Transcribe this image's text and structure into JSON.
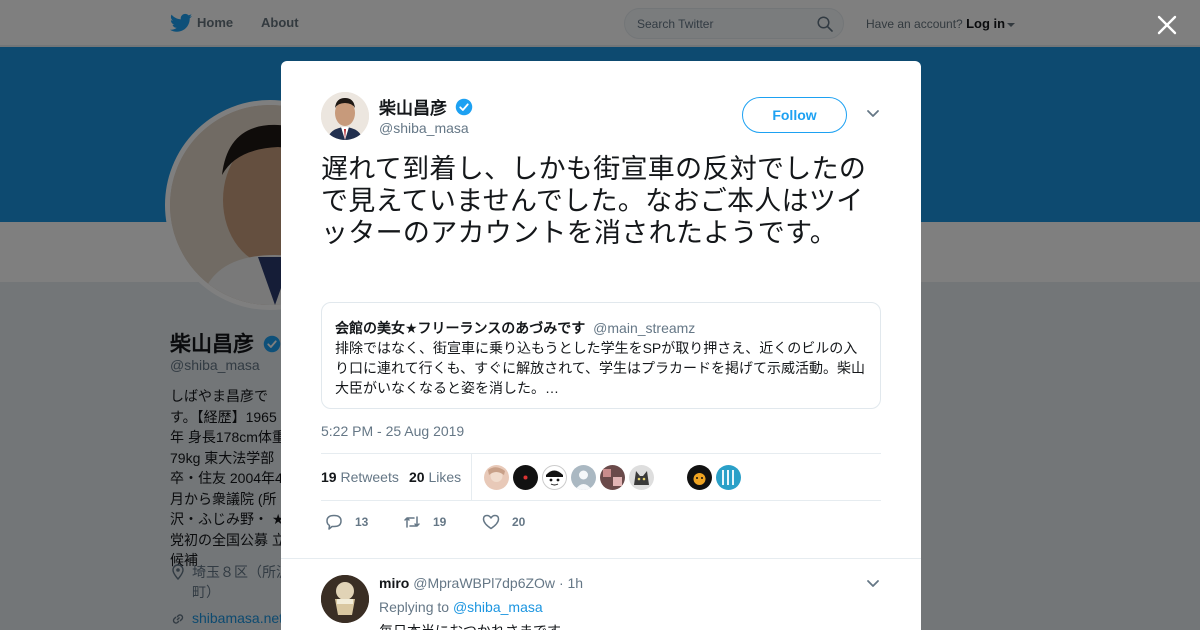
{
  "nav": {
    "home": "Home",
    "about": "About",
    "search_placeholder": "Search Twitter",
    "have_account": "Have an account?",
    "login": "Log in"
  },
  "profile": {
    "name": "柴山昌彦",
    "handle": "@shiba_masa",
    "bio": "しばやま昌彦です。【経歴】1965年 身長178cm体重79kg 東大法学部卒・住友 2004年4月から衆議院 (所沢・ふじみ野・ ★党初の全国公募 立候補",
    "location": "埼玉８区（所沢 町）",
    "url": "shibamasa.net"
  },
  "tweet": {
    "author_name": "柴山昌彦",
    "author_handle": "@shiba_masa",
    "follow_label": "Follow",
    "text": "遅れて到着し、しかも街宣車の反対でしたので見えていませんでした。なおご本人はツイッターのアカウントを消されたようです。",
    "quote": {
      "name": "会館の美女★フリーランスのあづみです",
      "handle": "@main_streamz",
      "text": "排除ではなく、街宣車に乗り込もうとした学生をSPが取り押さえ、近くのビルの入り口に連れて行くも、すぐに解放されて、学生はプラカードを掲げて示威活動。柴山大臣がいなくなると姿を消した。…"
    },
    "timestamp": "5:22 PM - 25 Aug 2019",
    "retweets_count": "19",
    "retweets_label": "Retweets",
    "likes_count": "20",
    "likes_label": "Likes",
    "actions": {
      "reply_count": "13",
      "retweet_count": "19",
      "like_count": "20"
    }
  },
  "reply": {
    "name": "miro",
    "handle": "@MpraWBPl7dp6ZOw",
    "age": "· 1h",
    "replying_to_label": "Replying to",
    "replying_to_handle": "@shiba_masa",
    "text": "毎日本当におつかれさまです"
  },
  "colors": {
    "brand_blue": "#1da1f2",
    "banner_blue": "#1b95e0",
    "link_blue": "#1b95e0",
    "muted_gray": "#657786"
  }
}
